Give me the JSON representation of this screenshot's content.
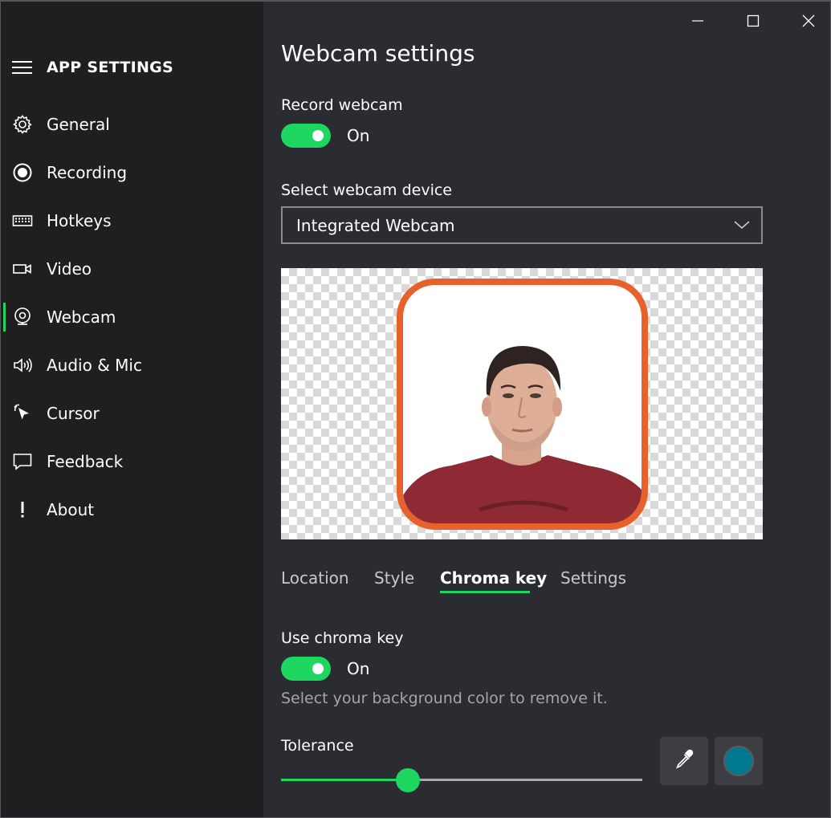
{
  "window": {
    "title_buttons": [
      "minimize-icon",
      "maximize-icon",
      "close-icon"
    ]
  },
  "sidebar": {
    "title": "APP SETTINGS",
    "items": [
      {
        "label": "General",
        "icon": "gear-icon"
      },
      {
        "label": "Recording",
        "icon": "record-icon"
      },
      {
        "label": "Hotkeys",
        "icon": "keyboard-icon"
      },
      {
        "label": "Video",
        "icon": "video-camera-icon"
      },
      {
        "label": "Webcam",
        "icon": "webcam-icon",
        "active": true
      },
      {
        "label": "Audio & Mic",
        "icon": "speaker-icon"
      },
      {
        "label": "Cursor",
        "icon": "cursor-icon"
      },
      {
        "label": "Feedback",
        "icon": "speech-bubble-icon"
      },
      {
        "label": "About",
        "icon": "exclamation-icon"
      }
    ]
  },
  "main": {
    "title": "Webcam settings",
    "record_webcam": {
      "label": "Record webcam",
      "state": "On",
      "on": true
    },
    "device": {
      "label": "Select webcam device",
      "value": "Integrated Webcam"
    },
    "preview": {
      "frame_color": "#e8612a"
    },
    "tabs": [
      {
        "label": "Location"
      },
      {
        "label": "Style"
      },
      {
        "label": "Chroma key",
        "active": true
      },
      {
        "label": "Settings"
      }
    ],
    "chroma": {
      "label": "Use chroma key",
      "state": "On",
      "on": true,
      "hint": "Select your background color to remove it.",
      "tolerance_label": "Tolerance",
      "tolerance_fraction": 0.35,
      "key_color": "#00788f"
    }
  },
  "colors": {
    "accent": "#1ed760",
    "sidebar_bg": "#1f1f21",
    "content_bg": "#2b2c31"
  }
}
